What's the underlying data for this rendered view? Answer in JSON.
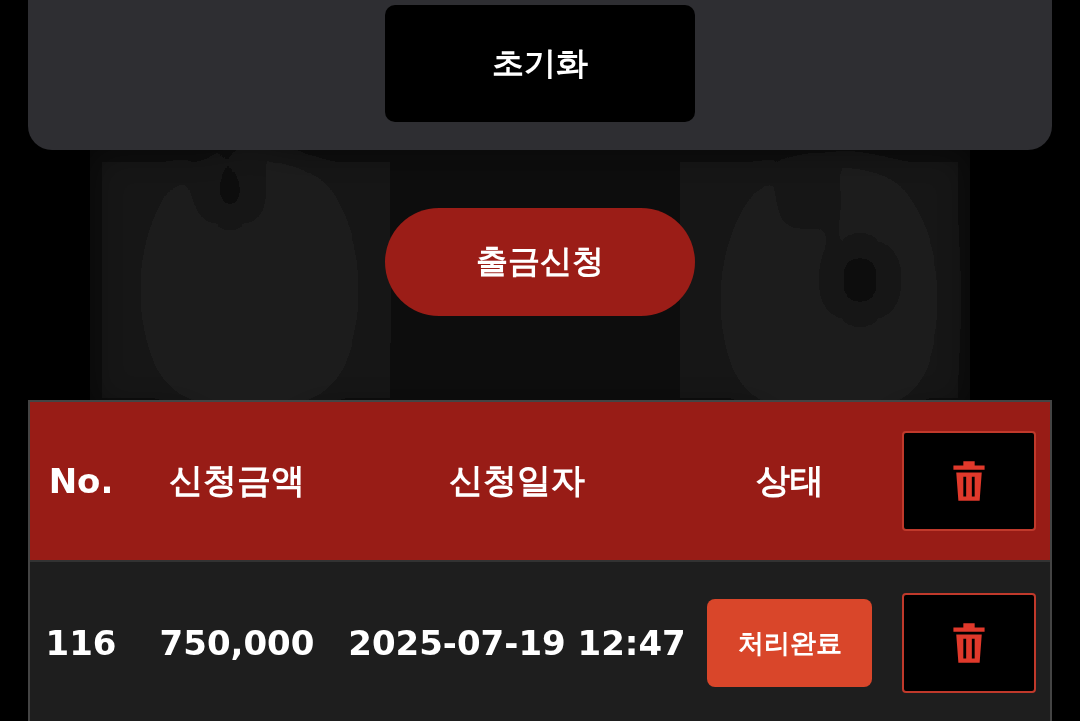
{
  "reset_button": "초기화",
  "withdraw_button": "출금신청",
  "table": {
    "columns": [
      "No.",
      "신청금액",
      "신청일자",
      "상태"
    ],
    "rows": [
      {
        "no": "116",
        "amount": "750,000",
        "date": "2025-07-19 12:47",
        "status": "처리완료"
      }
    ]
  }
}
